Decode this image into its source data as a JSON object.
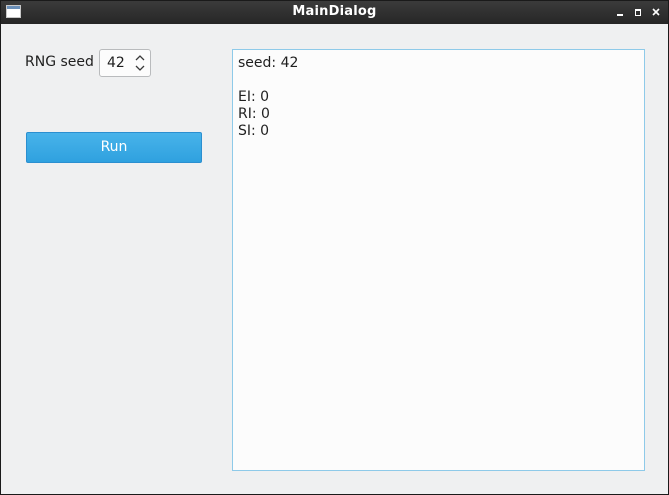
{
  "window": {
    "title": "MainDialog"
  },
  "controls": {
    "seed_label": "RNG seed",
    "seed_value": "42",
    "run_label": "Run"
  },
  "output": {
    "lines": [
      "seed: 42",
      "",
      "EI: 0",
      "RI: 0",
      "SI: 0"
    ]
  },
  "colors": {
    "accent": "#3daee9",
    "output_border": "#8ecae9",
    "window_bg": "#eff0f1",
    "titlebar": "#2e2e2e"
  },
  "icons": {
    "app": "window-icon",
    "minimize": "minimize-icon",
    "maximize": "maximize-icon",
    "close": "close-icon",
    "spin_up": "chevron-up-icon",
    "spin_down": "chevron-down-icon"
  }
}
